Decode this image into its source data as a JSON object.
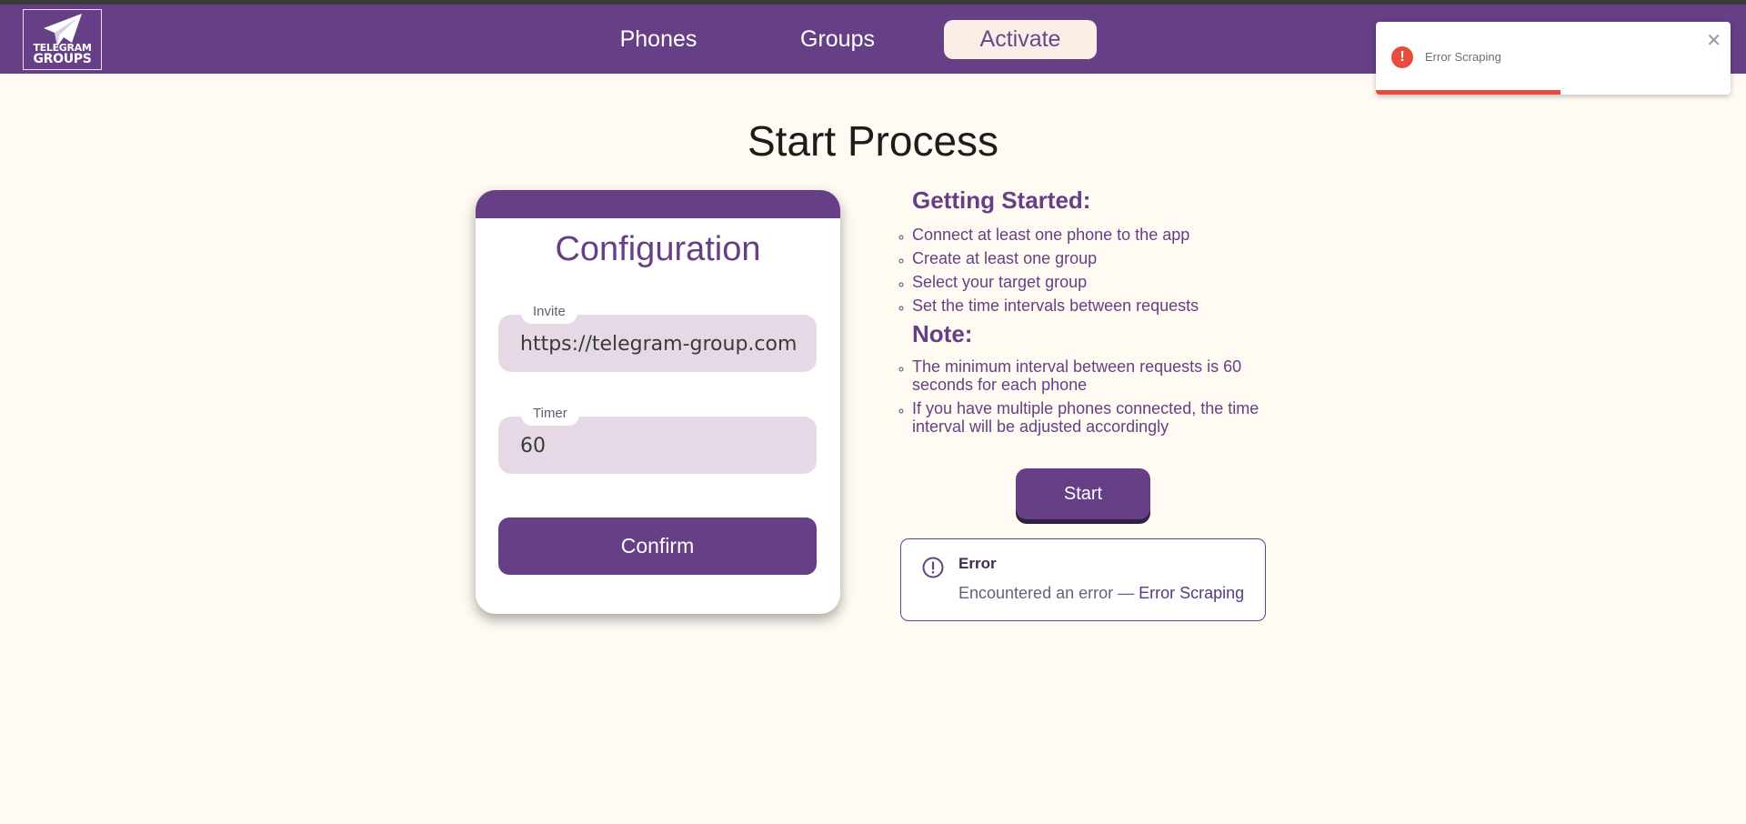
{
  "logo": {
    "line1": "TELEGRAM",
    "line2": "GROUPS"
  },
  "nav": {
    "phones": "Phones",
    "groups": "Groups",
    "activate": "Activate"
  },
  "page_title": "Start Process",
  "config": {
    "title": "Configuration",
    "invite_label": "Invite",
    "invite_value": "https://telegram-group.com/",
    "timer_label": "Timer",
    "timer_value": "60",
    "confirm_label": "Confirm"
  },
  "getting_started": {
    "heading": "Getting Started:",
    "items": [
      "Connect at least one phone to the app",
      "Create at least one group",
      "Select your target group",
      "Set the time intervals between requests"
    ]
  },
  "note": {
    "heading": "Note:",
    "items": [
      "The minimum interval between requests is 60 seconds for each phone",
      "If you have multiple phones connected, the time interval will be adjusted accordingly"
    ]
  },
  "start_label": "Start",
  "error": {
    "title": "Error",
    "message_prefix": "Encountered an error —",
    "message_detail": "Error Scraping"
  },
  "toast": {
    "text": "Error Scraping",
    "icon": "exclamation-icon",
    "progress_fraction": 0.52,
    "color": "#e74c3c"
  },
  "colors": {
    "brand": "#663f86",
    "background": "#fffbf3",
    "field": "#e5d9e6"
  }
}
